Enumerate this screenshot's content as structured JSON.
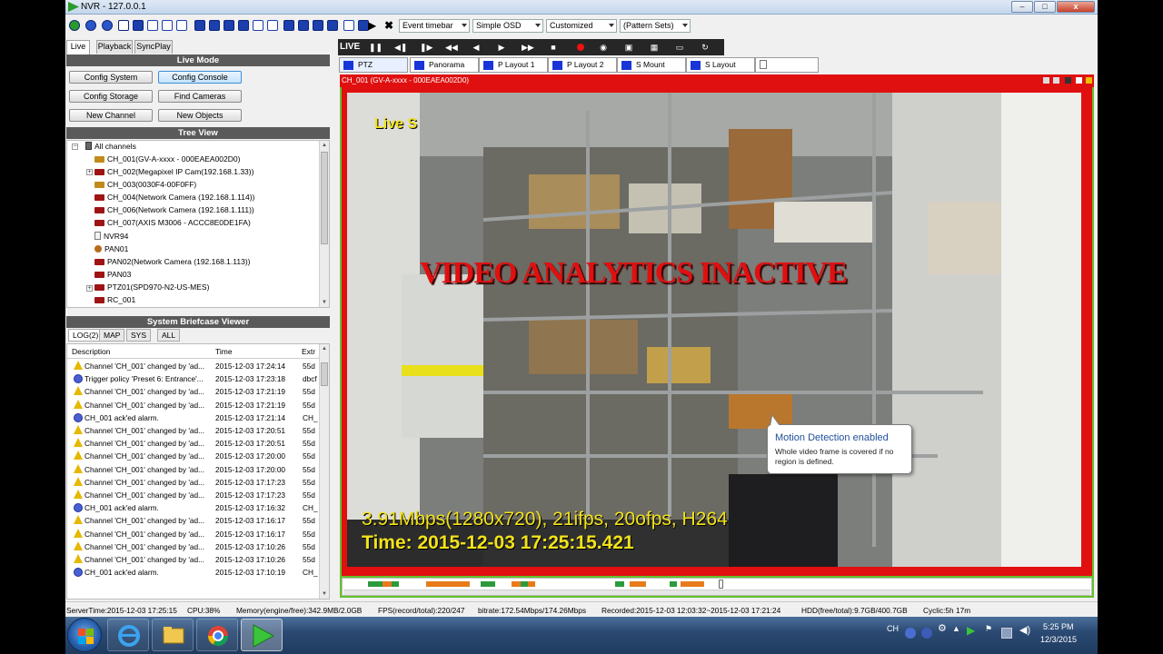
{
  "window": {
    "title": "NVR - 127.0.0.1",
    "controls": [
      "–",
      "□",
      "x"
    ]
  },
  "toolbar": {
    "event_timebar": "Event timebar",
    "osd": "Simple OSD",
    "customized": "Customized",
    "pattern_sets": "(Pattern Sets)"
  },
  "left_tabs": [
    "Live",
    "Playback",
    "SyncPlay"
  ],
  "live_mode": {
    "title": "Live Mode",
    "buttons": [
      "Config System",
      "Config Console",
      "Config Storage",
      "Find Cameras",
      "New Channel",
      "New Objects"
    ]
  },
  "tree": {
    "title": "Tree View",
    "items": [
      {
        "label": "All channels",
        "icon": "device-icon"
      },
      {
        "label": "CH_001(GV-A-xxxx - 000EAEA002D0)",
        "icon": "ptz-camera-icon"
      },
      {
        "label": "CH_002(Megapixel IP Cam(192.168.1.33))",
        "icon": "camera-icon"
      },
      {
        "label": "CH_003(0030F4-00F0FF)",
        "icon": "ptz-camera-icon"
      },
      {
        "label": "CH_004(Network Camera (192.168.1.114))",
        "icon": "camera-icon"
      },
      {
        "label": "CH_006(Network Camera (192.168.1.111))",
        "icon": "camera-icon"
      },
      {
        "label": "CH_007(AXIS M3006 - ACCC8E0DE1FA)",
        "icon": "camera-icon"
      },
      {
        "label": "NVR94",
        "icon": "disk-icon"
      },
      {
        "label": "PAN01",
        "icon": "panorama-icon"
      },
      {
        "label": "PAN02(Network Camera (192.168.1.113))",
        "icon": "camera-icon"
      },
      {
        "label": "PAN03",
        "icon": "camera-icon"
      },
      {
        "label": "PTZ01(SPD970-N2-US-MES)",
        "icon": "camera-icon"
      },
      {
        "label": "RC_001",
        "icon": "camera-icon"
      }
    ]
  },
  "briefcase": {
    "title": "System Briefcase Viewer",
    "tabs": [
      "LOG(2)",
      "MAP",
      "SYS",
      "ALL"
    ],
    "columns": [
      "Description",
      "Time",
      "Extr"
    ],
    "rows": [
      {
        "icon": "warn",
        "desc": "Channel 'CH_001' changed by 'ad...",
        "time": "2015-12-03 17:24:14",
        "extra": "55d"
      },
      {
        "icon": "info",
        "desc": "Trigger policy 'Preset 6: Entrance'...",
        "time": "2015-12-03 17:23:18",
        "extra": "dbcf"
      },
      {
        "icon": "warn",
        "desc": "Channel 'CH_001' changed by 'ad...",
        "time": "2015-12-03 17:21:19",
        "extra": "55d"
      },
      {
        "icon": "warn",
        "desc": "Channel 'CH_001' changed by 'ad...",
        "time": "2015-12-03 17:21:19",
        "extra": "55d"
      },
      {
        "icon": "info",
        "desc": "CH_001 ack'ed alarm.",
        "time": "2015-12-03 17:21:14",
        "extra": "CH_"
      },
      {
        "icon": "warn",
        "desc": "Channel 'CH_001' changed by 'ad...",
        "time": "2015-12-03 17:20:51",
        "extra": "55d"
      },
      {
        "icon": "warn",
        "desc": "Channel 'CH_001' changed by 'ad...",
        "time": "2015-12-03 17:20:51",
        "extra": "55d"
      },
      {
        "icon": "warn",
        "desc": "Channel 'CH_001' changed by 'ad...",
        "time": "2015-12-03 17:20:00",
        "extra": "55d"
      },
      {
        "icon": "warn",
        "desc": "Channel 'CH_001' changed by 'ad...",
        "time": "2015-12-03 17:20:00",
        "extra": "55d"
      },
      {
        "icon": "warn",
        "desc": "Channel 'CH_001' changed by 'ad...",
        "time": "2015-12-03 17:17:23",
        "extra": "55d"
      },
      {
        "icon": "warn",
        "desc": "Channel 'CH_001' changed by 'ad...",
        "time": "2015-12-03 17:17:23",
        "extra": "55d"
      },
      {
        "icon": "info",
        "desc": "CH_001 ack'ed alarm.",
        "time": "2015-12-03 17:16:32",
        "extra": "CH_"
      },
      {
        "icon": "warn",
        "desc": "Channel 'CH_001' changed by 'ad...",
        "time": "2015-12-03 17:16:17",
        "extra": "55d"
      },
      {
        "icon": "warn",
        "desc": "Channel 'CH_001' changed by 'ad...",
        "time": "2015-12-03 17:16:17",
        "extra": "55d"
      },
      {
        "icon": "warn",
        "desc": "Channel 'CH_001' changed by 'ad...",
        "time": "2015-12-03 17:10:26",
        "extra": "55d"
      },
      {
        "icon": "warn",
        "desc": "Channel 'CH_001' changed by 'ad...",
        "time": "2015-12-03 17:10:26",
        "extra": "55d"
      },
      {
        "icon": "info",
        "desc": "CH_001 ack'ed alarm.",
        "time": "2015-12-03 17:10:19",
        "extra": "CH_"
      }
    ]
  },
  "viewer": {
    "live_label": "LIVE",
    "tabs": [
      "PTZ",
      "Panorama",
      "P Layout 1",
      "P Layout 2",
      "S Mount",
      "S Layout"
    ],
    "channel_header": "CH_001 (GV-A-xxxx - 000EAEA002D0)",
    "osd_live": "Live S",
    "osd_inactive": "VIDEO ANALYTICS INACTIVE",
    "osd_stats": "3.91Mbps(1280x720), 21ifps, 20ofps, H264",
    "osd_time": "Time: 2015-12-03 17:25:15.421",
    "tooltip_title": "Motion Detection enabled",
    "tooltip_text": "Whole video frame is covered if no region is defined."
  },
  "status": {
    "server_time": "ServerTime:2015-12-03 17:25:15",
    "cpu": "CPU:38%",
    "memory": "Memory(engine/free):342.9MB/2.0GB",
    "fps": "FPS(record/total):220/247",
    "bitrate": "bitrate:172.54Mbps/174.26Mbps",
    "recorded": "Recorded:2015-12-03 12:03:32~2015-12-03 17:21:24",
    "hdd": "HDD(free/total):9.7GB/400.7GB",
    "cyclic": "Cyclic:5h 17m"
  },
  "taskbar": {
    "lang": "CH",
    "time": "5:25 PM",
    "date": "12/3/2015"
  },
  "colors": {
    "accent_red": "#e01010",
    "osd_yellow": "#f2e21a",
    "frame_green": "#64c12a",
    "tab_blue": "#1836d8"
  }
}
